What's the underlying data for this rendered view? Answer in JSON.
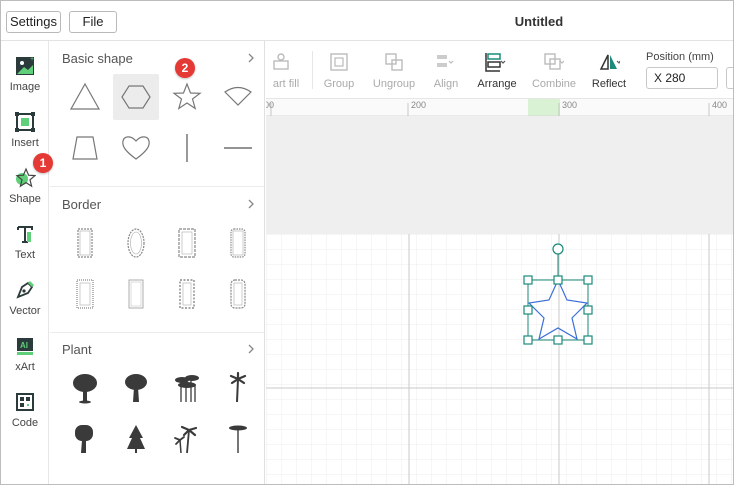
{
  "topbar": {
    "settings_label": "Settings",
    "file_label": "File",
    "title": "Untitled"
  },
  "rail": {
    "items": [
      {
        "label": "Image",
        "icon": "image-icon"
      },
      {
        "label": "Insert",
        "icon": "insert-icon"
      },
      {
        "label": "Shape",
        "icon": "star-icon"
      },
      {
        "label": "Text",
        "icon": "text-icon"
      },
      {
        "label": "Vector",
        "icon": "pen-icon"
      },
      {
        "label": "xArt",
        "icon": "ai-icon"
      },
      {
        "label": "Code",
        "icon": "qr-code-icon"
      }
    ]
  },
  "panel": {
    "sections": [
      {
        "title": "Basic shape",
        "items": [
          "triangle",
          "hexagon",
          "star",
          "fan",
          "trapezoid",
          "heart",
          "vertical-line",
          "horizontal-line"
        ],
        "selected": "hexagon"
      },
      {
        "title": "Border",
        "items": [
          "border-1",
          "border-2",
          "border-3",
          "border-4",
          "border-5",
          "border-6",
          "border-7",
          "border-8"
        ]
      },
      {
        "title": "Plant",
        "items": [
          "tree-1",
          "tree-2",
          "tree-3",
          "palm-1",
          "tree-4",
          "pine",
          "palm-2",
          "palm-3"
        ]
      }
    ]
  },
  "toolbar": {
    "items": [
      {
        "label": "art fill",
        "enabled": false
      },
      {
        "label": "Group",
        "enabled": false
      },
      {
        "label": "Ungroup",
        "enabled": false
      },
      {
        "label": "Align",
        "enabled": false
      },
      {
        "label": "Arrange",
        "enabled": true
      },
      {
        "label": "Combine",
        "enabled": false
      },
      {
        "label": "Reflect",
        "enabled": true
      }
    ],
    "position_label": "Position (mm)",
    "position_x": "X 280"
  },
  "ruler": {
    "ticks": [
      "00",
      "200",
      "300",
      "400"
    ]
  },
  "badges": [
    "1",
    "2"
  ],
  "colors": {
    "accent": "#1a8a7a",
    "badge": "#e53935",
    "selected_shape": "#3a6fd8",
    "ruler_highlight": "#d9f2d3"
  }
}
